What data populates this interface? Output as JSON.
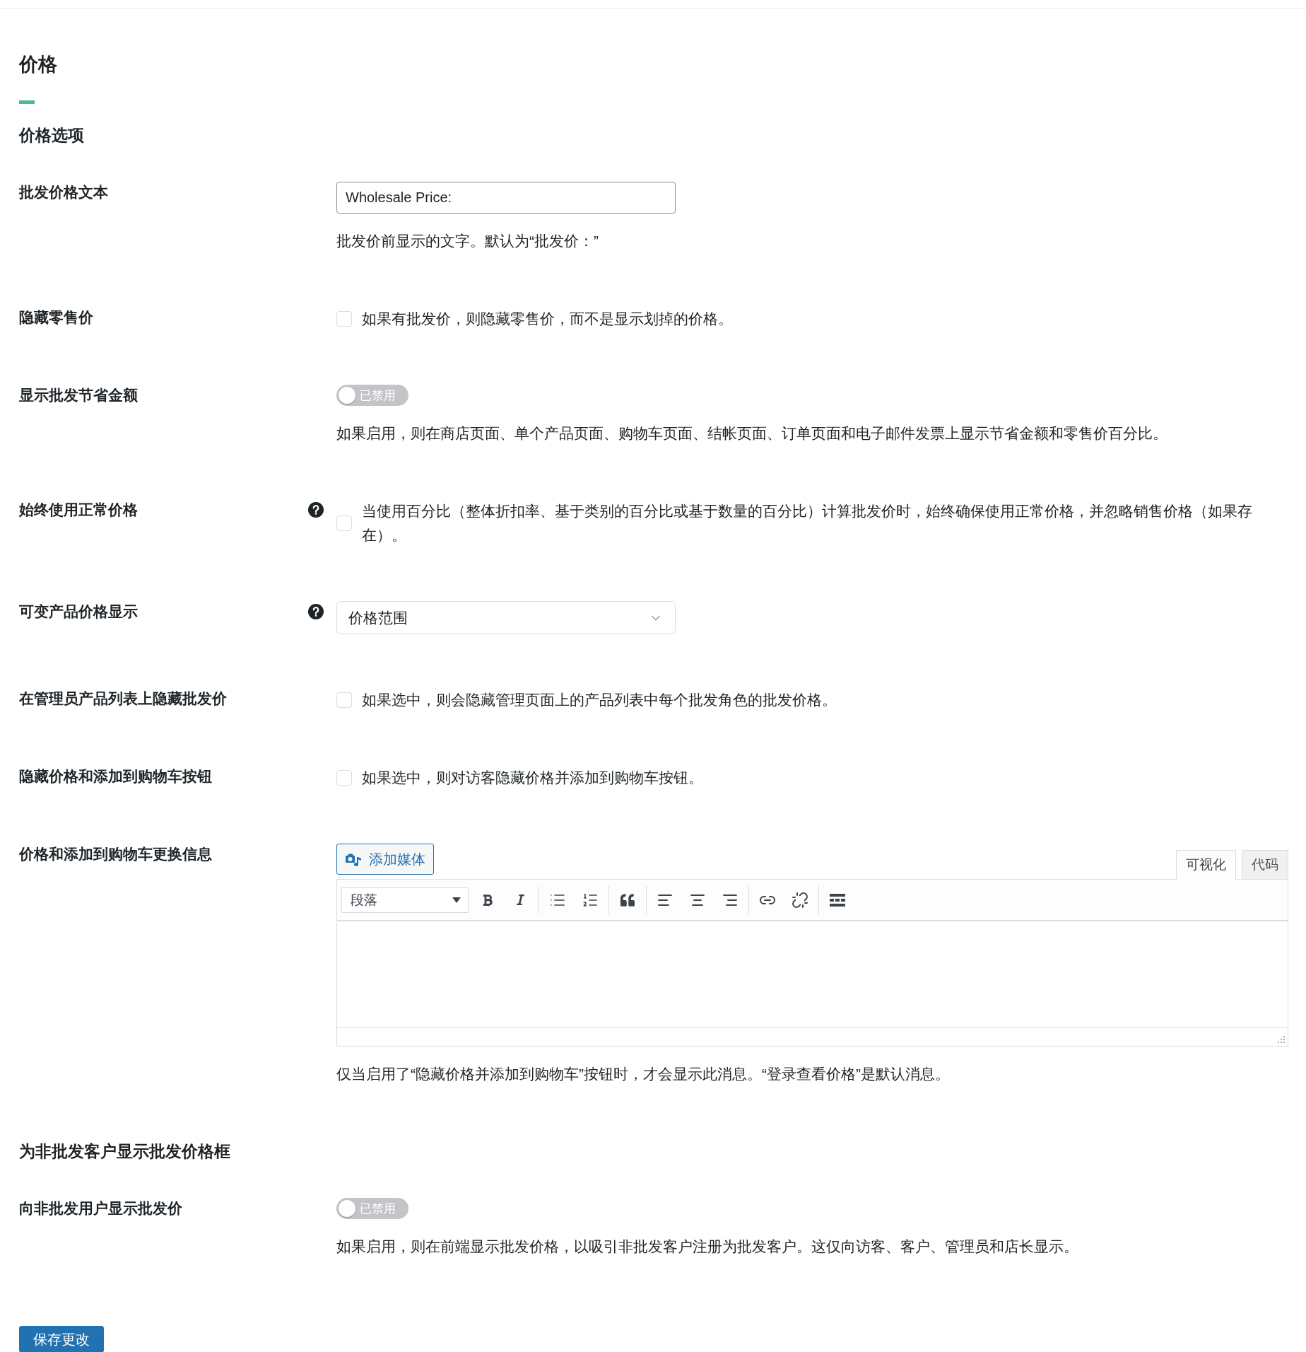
{
  "title": "价格",
  "sections": [
    {
      "heading": "价格选项",
      "rows": [
        {
          "kind": "text",
          "label": "批发价格文本",
          "help": false,
          "value": "Wholesale Price:",
          "description": "批发价前显示的文字。默认为“批发价：”"
        },
        {
          "kind": "checkbox",
          "label": "隐藏零售价",
          "help": false,
          "checked": false,
          "text": "如果有批发价，则隐藏零售价，而不是显示划掉的价格。"
        },
        {
          "kind": "toggle",
          "label": "显示批发节省金额",
          "help": false,
          "on": false,
          "state_text": "已禁用",
          "description": "如果启用，则在商店页面、单个产品页面、购物车页面、结帐页面、订单页面和电子邮件发票上显示节省金额和零售价百分比。"
        },
        {
          "kind": "checkbox",
          "label": "始终使用正常价格",
          "help": true,
          "checked": false,
          "text": "当使用百分比（整体折扣率、基于类别的百分比或基于数量的百分比）计算批发价时，始终确保使用正常价格，并忽略销售价格（如果存在）。"
        },
        {
          "kind": "select",
          "label": "可变产品价格显示",
          "help": true,
          "value": "价格范围"
        },
        {
          "kind": "checkbox",
          "label": "在管理员产品列表上隐藏批发价",
          "help": false,
          "checked": false,
          "text": "如果选中，则会隐藏管理页面上的产品列表中每个批发角色的批发价格。"
        },
        {
          "kind": "checkbox",
          "label": "隐藏价格和添加到购物车按钮",
          "help": false,
          "checked": false,
          "text": "如果选中，则对访客隐藏价格并添加到购物车按钮。"
        },
        {
          "kind": "editor",
          "label": "价格和添加到购物车更换信息",
          "help": false,
          "media_button": "添加媒体",
          "tabs": [
            {
              "label": "可视化",
              "selected": true
            },
            {
              "label": "代码",
              "selected": false
            }
          ],
          "format": "段落",
          "description": "仅当启用了“隐藏价格并添加到购物车”按钮时，才会显示此消息。“登录查看价格”是默认消息。"
        }
      ]
    },
    {
      "heading": "为非批发客户显示批发价格框",
      "rows": [
        {
          "kind": "toggle",
          "label": "向非批发用户显示批发价",
          "help": false,
          "on": false,
          "state_text": "已禁用",
          "description": "如果启用，则在前端显示批发价格，以吸引非批发客户注册为批发客户。这仅向访客、客户、管理员和店长显示。"
        }
      ]
    }
  ],
  "save_button": "保存更改"
}
